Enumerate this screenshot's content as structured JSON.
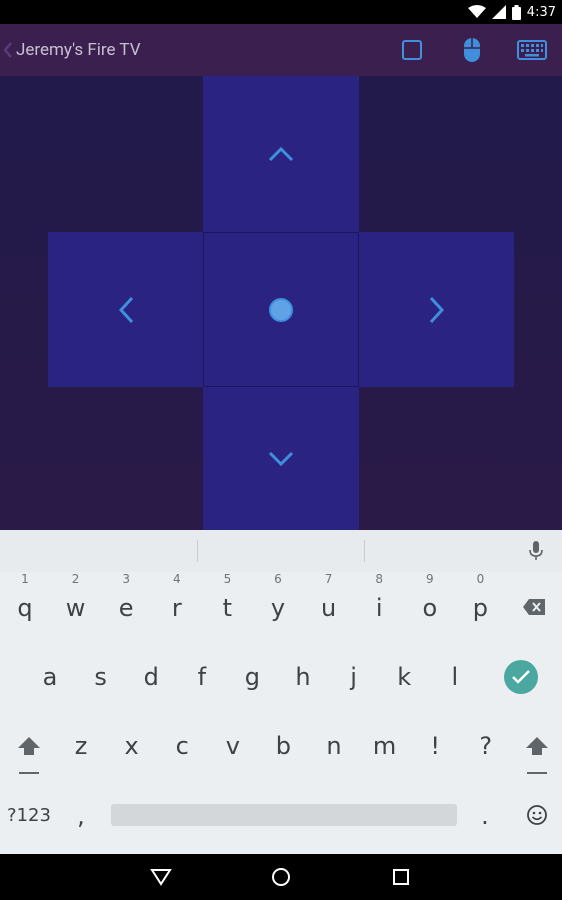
{
  "status_bar": {
    "time": "4:37",
    "icons": [
      "wifi-icon",
      "signal-icon",
      "battery-icon"
    ]
  },
  "app_bar": {
    "title": "Jeremy's Fire TV",
    "icons": [
      "back-icon",
      "square-icon",
      "mouse-icon",
      "keyboard-icon"
    ],
    "accent_color": "#3f8fdc"
  },
  "remote": {
    "icons": [
      "chevron-up-icon",
      "chevron-left-icon",
      "select-dot-icon",
      "chevron-right-icon",
      "chevron-down-icon"
    ],
    "pad_color": "#2a2381"
  },
  "keyboard": {
    "row1": [
      {
        "label": "q",
        "hint": "1"
      },
      {
        "label": "w",
        "hint": "2"
      },
      {
        "label": "e",
        "hint": "3"
      },
      {
        "label": "r",
        "hint": "4"
      },
      {
        "label": "t",
        "hint": "5"
      },
      {
        "label": "y",
        "hint": "6"
      },
      {
        "label": "u",
        "hint": "7"
      },
      {
        "label": "i",
        "hint": "8"
      },
      {
        "label": "o",
        "hint": "9"
      },
      {
        "label": "p",
        "hint": "0"
      }
    ],
    "row2": [
      "a",
      "s",
      "d",
      "f",
      "g",
      "h",
      "j",
      "k",
      "l"
    ],
    "row3": [
      "z",
      "x",
      "c",
      "v",
      "b",
      "n",
      "m",
      "!",
      "?"
    ],
    "row4": {
      "symbols": "?123",
      "comma": ",",
      "period": ".",
      "emoji_icon": "smiley-icon"
    },
    "enter_color": "#4aa8a0"
  },
  "nav_bar": {
    "icons": [
      "back-triangle-icon",
      "home-circle-icon",
      "recents-square-icon"
    ]
  }
}
